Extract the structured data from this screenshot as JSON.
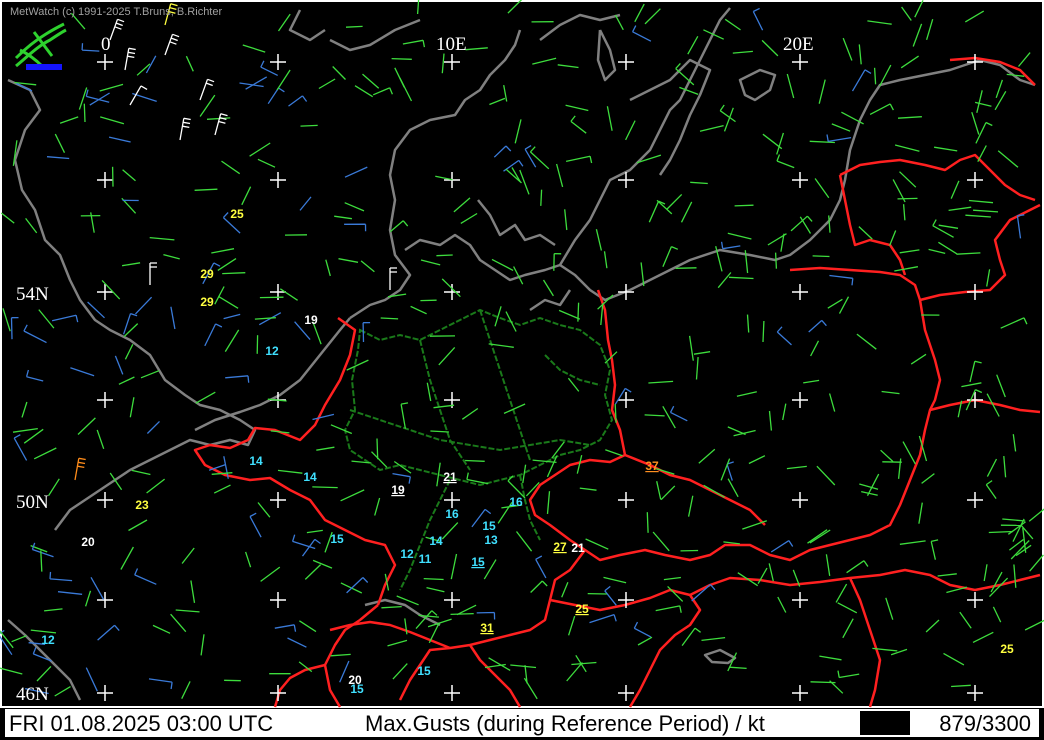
{
  "app": {
    "credit": "MetWatch  (c) 1991-2025 T.Bruns, B.Richter"
  },
  "status": {
    "datetime": "FRI 01.08.2025 03:00 UTC",
    "title": "Max.Gusts (during Reference Period) / kt",
    "count": "879/3300"
  },
  "grid_labels": {
    "lon": [
      "0",
      "10E",
      "20E"
    ],
    "lat": [
      "54N",
      "50N",
      "46N"
    ]
  },
  "colors": {
    "background": "#000000",
    "coastline": "#808080",
    "border": "#ff0000",
    "region_border": "#1a7a1a",
    "grid_cross": "#ffffff",
    "wind_green": "#3ddc3d",
    "wind_blue": "#3a7ad8",
    "wind_white": "#ffffff",
    "wind_yellow": "#ffff40",
    "wind_orange": "#ff8c1a",
    "gust_cyan": "#40e0ff",
    "gust_white": "#ffffff",
    "gust_yellow": "#ffff40",
    "gust_orange": "#ff9020"
  },
  "gust_labels": [
    {
      "text": "25",
      "color": "yellow",
      "u": false
    },
    {
      "text": "29",
      "color": "yellow",
      "u": false
    },
    {
      "text": "29",
      "color": "yellow",
      "u": false
    },
    {
      "text": "19",
      "color": "white",
      "u": false
    },
    {
      "text": "12",
      "color": "cyan",
      "u": false
    },
    {
      "text": "14",
      "color": "cyan",
      "u": false
    },
    {
      "text": "14",
      "color": "cyan",
      "u": false
    },
    {
      "text": "21",
      "color": "white",
      "u": true
    },
    {
      "text": "19",
      "color": "white",
      "u": true
    },
    {
      "text": "37",
      "color": "orange",
      "u": true
    },
    {
      "text": "16",
      "color": "cyan",
      "u": false
    },
    {
      "text": "16",
      "color": "cyan",
      "u": false
    },
    {
      "text": "15",
      "color": "cyan",
      "u": false
    },
    {
      "text": "13",
      "color": "cyan",
      "u": false
    },
    {
      "text": "23",
      "color": "yellow",
      "u": false
    },
    {
      "text": "20",
      "color": "white",
      "u": false
    },
    {
      "text": "15",
      "color": "cyan",
      "u": false
    },
    {
      "text": "14",
      "color": "cyan",
      "u": false
    },
    {
      "text": "27",
      "color": "yellow",
      "u": true
    },
    {
      "text": "21",
      "color": "white",
      "u": false
    },
    {
      "text": "12",
      "color": "cyan",
      "u": false
    },
    {
      "text": "11",
      "color": "cyan",
      "u": false
    },
    {
      "text": "15",
      "color": "cyan",
      "u": true
    },
    {
      "text": "25",
      "color": "yellow",
      "u": true
    },
    {
      "text": "31",
      "color": "yellow",
      "u": true
    },
    {
      "text": "12",
      "color": "cyan",
      "u": false
    },
    {
      "text": "25",
      "color": "yellow",
      "u": false
    },
    {
      "text": "15",
      "color": "cyan",
      "u": false
    },
    {
      "text": "20",
      "color": "white",
      "u": false
    },
    {
      "text": "15",
      "color": "cyan",
      "u": false
    }
  ]
}
